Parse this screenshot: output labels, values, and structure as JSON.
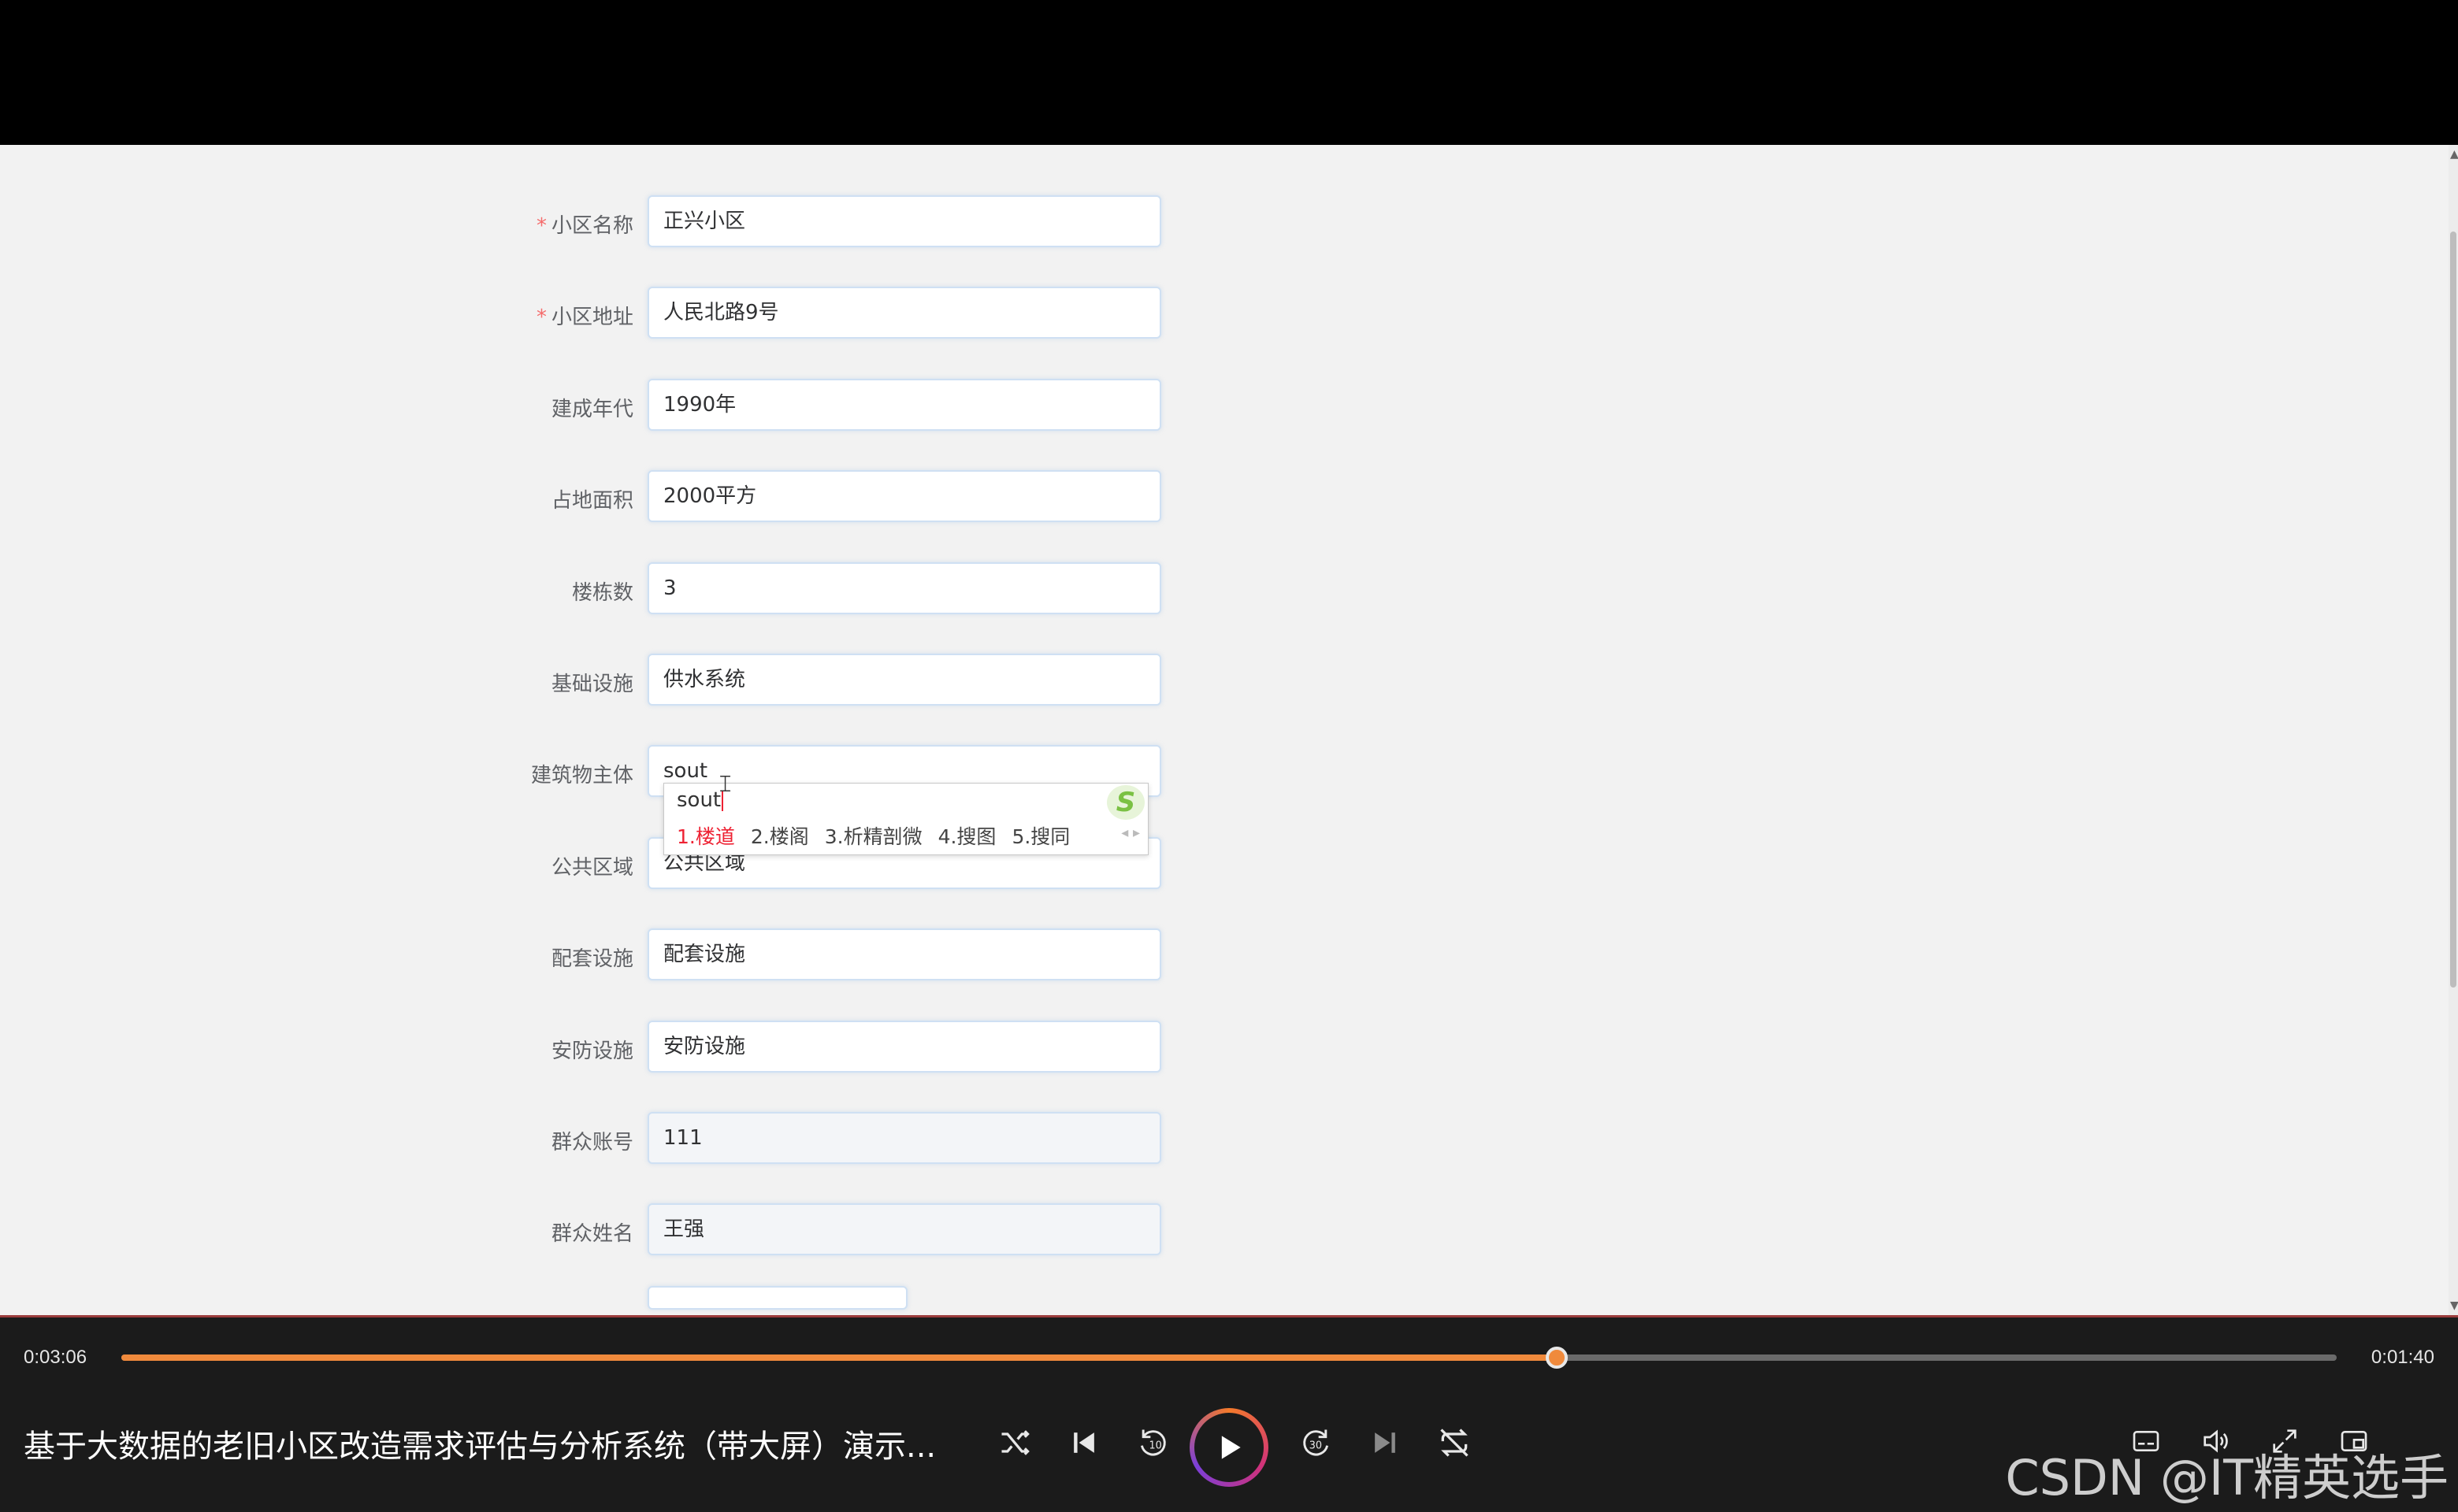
{
  "form": {
    "rows": [
      {
        "label": "小区名称",
        "required": true,
        "value": "正兴小区"
      },
      {
        "label": "小区地址",
        "required": true,
        "value": "人民北路9号"
      },
      {
        "label": "建成年代",
        "required": false,
        "value": "1990年"
      },
      {
        "label": "占地面积",
        "required": false,
        "value": "2000平方"
      },
      {
        "label": "楼栋数",
        "required": false,
        "value": "3"
      },
      {
        "label": "基础设施",
        "required": false,
        "value": "供水系统"
      },
      {
        "label": "建筑物主体",
        "required": false,
        "value": "sout"
      },
      {
        "label": "公共区域",
        "required": false,
        "value": "公共区域"
      },
      {
        "label": "配套设施",
        "required": false,
        "value": "配套设施"
      },
      {
        "label": "安防设施",
        "required": false,
        "value": "安防设施"
      },
      {
        "label": "群众账号",
        "required": false,
        "value": "111"
      },
      {
        "label": "群众姓名",
        "required": false,
        "value": "王强"
      }
    ],
    "required_mark": "*"
  },
  "ime": {
    "typed": "sout",
    "logo": "S",
    "candidates": [
      "1.楼道",
      "2.楼阁",
      "3.析精剖微",
      "4.搜图",
      "5.搜同"
    ],
    "selected_index": 0,
    "pager": "◂ ▸"
  },
  "player": {
    "current_time": "0:03:06",
    "total_time": "0:01:40",
    "progress": 0.648,
    "title": "基于大数据的老旧小区改造需求评估与分析系统（带大屏）演示...",
    "controls": [
      "shuffle-icon",
      "previous-icon",
      "rewind-10-icon",
      "play-icon",
      "forward-30-icon",
      "next-icon",
      "repeat-off-icon"
    ],
    "right_controls": [
      "subtitles-icon",
      "volume-icon",
      "fullscreen-icon",
      "miniplayer-icon"
    ]
  },
  "watermark": "CSDN @IT精英选手",
  "colors": {
    "accent": "#f08a3c",
    "required": "#f56c6c",
    "ime_selected": "#e22233"
  }
}
